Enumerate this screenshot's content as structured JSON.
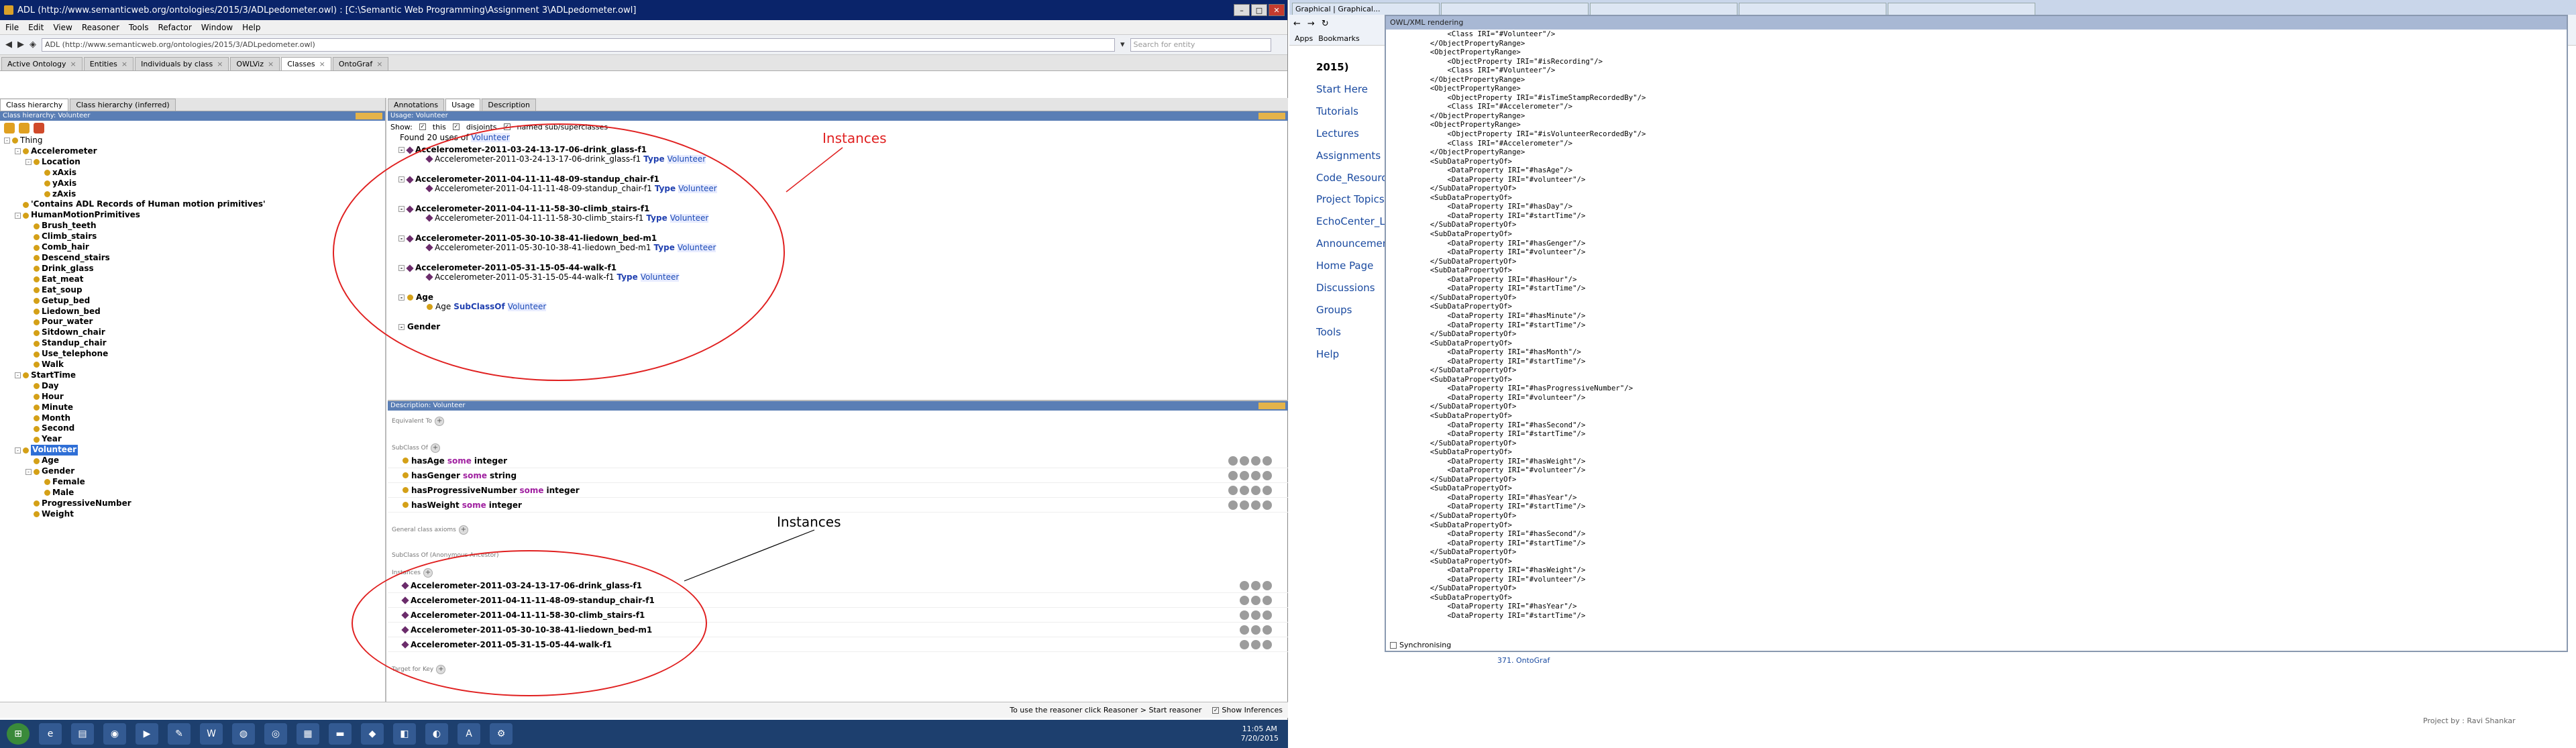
{
  "protege": {
    "title": "ADL (http://www.semanticweb.org/ontologies/2015/3/ADLpedometer.owl) : [C:\\Semantic Web Programming\\Assignment 3\\ADLpedometer.owl]",
    "menu": [
      "File",
      "Edit",
      "View",
      "Reasoner",
      "Tools",
      "Refactor",
      "Window",
      "Help"
    ],
    "iri": "ADL (http://www.semanticweb.org/ontologies/2015/3/ADLpedometer.owl)",
    "search_placeholder": "Search for entity",
    "tabs": [
      "Active Ontology",
      "Entities",
      "Individuals by class",
      "OWLViz",
      "Classes",
      "OntoGraf"
    ],
    "left_tabs": [
      "Class hierarchy",
      "Class hierarchy (inferred)"
    ],
    "left_header": "Class hierarchy: Volunteer",
    "tree": [
      {
        "label": "Thing",
        "depth": 0,
        "bold": false,
        "toggle": "-"
      },
      {
        "label": "Accelerometer",
        "depth": 1,
        "bold": true,
        "toggle": "-"
      },
      {
        "label": "Location",
        "depth": 2,
        "bold": true,
        "toggle": "-"
      },
      {
        "label": "xAxis",
        "depth": 3,
        "bold": true,
        "toggle": ""
      },
      {
        "label": "yAxis",
        "depth": 3,
        "bold": true,
        "toggle": ""
      },
      {
        "label": "zAxis",
        "depth": 3,
        "bold": true,
        "toggle": ""
      },
      {
        "label": "'Contains ADL Records of Human motion primitives'",
        "depth": 1,
        "bold": true,
        "toggle": ""
      },
      {
        "label": "HumanMotionPrimitives",
        "depth": 1,
        "bold": true,
        "toggle": "-"
      },
      {
        "label": "Brush_teeth",
        "depth": 2,
        "bold": true,
        "toggle": ""
      },
      {
        "label": "Climb_stairs",
        "depth": 2,
        "bold": true,
        "toggle": ""
      },
      {
        "label": "Comb_hair",
        "depth": 2,
        "bold": true,
        "toggle": ""
      },
      {
        "label": "Descend_stairs",
        "depth": 2,
        "bold": true,
        "toggle": ""
      },
      {
        "label": "Drink_glass",
        "depth": 2,
        "bold": true,
        "toggle": ""
      },
      {
        "label": "Eat_meat",
        "depth": 2,
        "bold": true,
        "toggle": ""
      },
      {
        "label": "Eat_soup",
        "depth": 2,
        "bold": true,
        "toggle": ""
      },
      {
        "label": "Getup_bed",
        "depth": 2,
        "bold": true,
        "toggle": ""
      },
      {
        "label": "Liedown_bed",
        "depth": 2,
        "bold": true,
        "toggle": ""
      },
      {
        "label": "Pour_water",
        "depth": 2,
        "bold": true,
        "toggle": ""
      },
      {
        "label": "Sitdown_chair",
        "depth": 2,
        "bold": true,
        "toggle": ""
      },
      {
        "label": "Standup_chair",
        "depth": 2,
        "bold": true,
        "toggle": ""
      },
      {
        "label": "Use_telephone",
        "depth": 2,
        "bold": true,
        "toggle": ""
      },
      {
        "label": "Walk",
        "depth": 2,
        "bold": true,
        "toggle": ""
      },
      {
        "label": "StartTime",
        "depth": 1,
        "bold": true,
        "toggle": "-"
      },
      {
        "label": "Day",
        "depth": 2,
        "bold": true,
        "toggle": ""
      },
      {
        "label": "Hour",
        "depth": 2,
        "bold": true,
        "toggle": ""
      },
      {
        "label": "Minute",
        "depth": 2,
        "bold": true,
        "toggle": ""
      },
      {
        "label": "Month",
        "depth": 2,
        "bold": true,
        "toggle": ""
      },
      {
        "label": "Second",
        "depth": 2,
        "bold": true,
        "toggle": ""
      },
      {
        "label": "Year",
        "depth": 2,
        "bold": true,
        "toggle": ""
      },
      {
        "label": "Volunteer",
        "depth": 1,
        "bold": true,
        "toggle": "-",
        "selected": true
      },
      {
        "label": "Age",
        "depth": 2,
        "bold": true,
        "toggle": ""
      },
      {
        "label": "Gender",
        "depth": 2,
        "bold": true,
        "toggle": "-"
      },
      {
        "label": "Female",
        "depth": 3,
        "bold": true,
        "toggle": ""
      },
      {
        "label": "Male",
        "depth": 3,
        "bold": true,
        "toggle": ""
      },
      {
        "label": "ProgressiveNumber",
        "depth": 2,
        "bold": true,
        "toggle": ""
      },
      {
        "label": "Weight",
        "depth": 2,
        "bold": true,
        "toggle": ""
      }
    ],
    "right_tabs": [
      "Annotations",
      "Usage",
      "Description"
    ],
    "usage_header": "Usage: Volunteer",
    "usage_opts": {
      "show": "Show:",
      "this": "this",
      "disjoints": "disjoints",
      "named": "named sub/superclasses"
    },
    "found": {
      "prefix": "Found 20 uses of",
      "cls": "Volunteer"
    },
    "usage_groups": [
      {
        "head": "Accelerometer-2011-03-24-13-17-06-drink_glass-f1",
        "child": "Accelerometer-2011-03-24-13-17-06-drink_glass-f1",
        "kw": "Type",
        "target": "Volunteer"
      },
      {
        "head": "Accelerometer-2011-04-11-11-48-09-standup_chair-f1",
        "child": "Accelerometer-2011-04-11-11-48-09-standup_chair-f1",
        "kw": "Type",
        "target": "Volunteer"
      },
      {
        "head": "Accelerometer-2011-04-11-11-58-30-climb_stairs-f1",
        "child": "Accelerometer-2011-04-11-11-58-30-climb_stairs-f1",
        "kw": "Type",
        "target": "Volunteer"
      },
      {
        "head": "Accelerometer-2011-05-30-10-38-41-liedown_bed-m1",
        "child": "Accelerometer-2011-05-30-10-38-41-liedown_bed-m1",
        "kw": "Type",
        "target": "Volunteer"
      },
      {
        "head": "Accelerometer-2011-05-31-15-05-44-walk-f1",
        "child": "Accelerometer-2011-05-31-15-05-44-walk-f1",
        "kw": "Type",
        "target": "Volunteer"
      },
      {
        "head": "Age",
        "child": "Age",
        "kw": "SubClassOf",
        "target": "Volunteer"
      }
    ],
    "usage_tail": "Gender",
    "desc_header": "Description: Volunteer",
    "sections": {
      "equiv": "Equivalent To",
      "sub": "SubClass Of",
      "gca": "General class axioms",
      "subanon": "SubClass Of (Anonymous Ancestor)",
      "inst": "Instances",
      "target": "Target for Key"
    },
    "subclass_rows": [
      {
        "prop": "hasAge",
        "kw": "some",
        "type": "integer"
      },
      {
        "prop": "hasGenger",
        "kw": "some",
        "type": "string"
      },
      {
        "prop": "hasProgressiveNumber",
        "kw": "some",
        "type": "integer"
      },
      {
        "prop": "hasWeight",
        "kw": "some",
        "type": "integer"
      }
    ],
    "instances": [
      "Accelerometer-2011-03-24-13-17-06-drink_glass-f1",
      "Accelerometer-2011-04-11-11-48-09-standup_chair-f1",
      "Accelerometer-2011-04-11-11-58-30-climb_stairs-f1",
      "Accelerometer-2011-05-30-10-38-41-liedown_bed-m1",
      "Accelerometer-2011-05-31-15-05-44-walk-f1"
    ],
    "annot_top": "Instances",
    "annot_bottom": "Instances",
    "status": {
      "reasoner": "To use the reasoner click Reasoner > Start reasoner",
      "infer": "Show Inferences"
    }
  },
  "taskbar": {
    "time": "11:05 AM",
    "date": "7/20/2015"
  },
  "browser": {
    "tabs": [
      "Graphical | Graphical...",
      "",
      "",
      "",
      ""
    ],
    "bookmarks": [
      "Apps",
      "Bookmarks"
    ],
    "sidebar": [
      "2015)",
      "Start Here",
      "Tutorials",
      "Lectures",
      "Assignments",
      "Code_Resourc",
      "Project Topics",
      "EchoCenter_Le",
      "Announcement",
      "Home Page",
      "Discussions",
      "Groups",
      "Tools",
      "Help"
    ],
    "footer": "Project by : Ravi Shankar",
    "below": "371. OntoGraf"
  },
  "owl": {
    "title": "OWL/XML rendering",
    "sync": "Synchronising",
    "lines": [
      "        <Class IRI=\"#Volunteer\"/>",
      "    </ObjectPropertyRange>",
      "    <ObjectPropertyRange>",
      "        <ObjectProperty IRI=\"#isRecording\"/>",
      "        <Class IRI=\"#Volunteer\"/>",
      "    </ObjectPropertyRange>",
      "    <ObjectPropertyRange>",
      "        <ObjectProperty IRI=\"#isTimeStampRecordedBy\"/>",
      "        <Class IRI=\"#Accelerometer\"/>",
      "    </ObjectPropertyRange>",
      "    <ObjectPropertyRange>",
      "        <ObjectProperty IRI=\"#isVolunteerRecordedBy\"/>",
      "        <Class IRI=\"#Accelerometer\"/>",
      "    </ObjectPropertyRange>",
      "    <SubDataPropertyOf>",
      "        <DataProperty IRI=\"#hasAge\"/>",
      "        <DataProperty IRI=\"#volunteer\"/>",
      "    </SubDataPropertyOf>",
      "    <SubDataPropertyOf>",
      "        <DataProperty IRI=\"#hasDay\"/>",
      "        <DataProperty IRI=\"#startTime\"/>",
      "    </SubDataPropertyOf>",
      "    <SubDataPropertyOf>",
      "        <DataProperty IRI=\"#hasGenger\"/>",
      "        <DataProperty IRI=\"#volunteer\"/>",
      "    </SubDataPropertyOf>",
      "    <SubDataPropertyOf>",
      "        <DataProperty IRI=\"#hasHour\"/>",
      "        <DataProperty IRI=\"#startTime\"/>",
      "    </SubDataPropertyOf>",
      "    <SubDataPropertyOf>",
      "        <DataProperty IRI=\"#hasMinute\"/>",
      "        <DataProperty IRI=\"#startTime\"/>",
      "    </SubDataPropertyOf>",
      "    <SubDataPropertyOf>",
      "        <DataProperty IRI=\"#hasMonth\"/>",
      "        <DataProperty IRI=\"#startTime\"/>",
      "    </SubDataPropertyOf>",
      "    <SubDataPropertyOf>",
      "        <DataProperty IRI=\"#hasProgressiveNumber\"/>",
      "        <DataProperty IRI=\"#volunteer\"/>",
      "    </SubDataPropertyOf>",
      "    <SubDataPropertyOf>",
      "        <DataProperty IRI=\"#hasSecond\"/>",
      "        <DataProperty IRI=\"#startTime\"/>",
      "    </SubDataPropertyOf>",
      "    <SubDataPropertyOf>",
      "        <DataProperty IRI=\"#hasWeight\"/>",
      "        <DataProperty IRI=\"#volunteer\"/>",
      "    </SubDataPropertyOf>",
      "    <SubDataPropertyOf>",
      "        <DataProperty IRI=\"#hasYear\"/>",
      "        <DataProperty IRI=\"#startTime\"/>",
      "    </SubDataPropertyOf>",
      "    <SubDataPropertyOf>",
      "        <DataProperty IRI=\"#hasSecond\"/>",
      "        <DataProperty IRI=\"#startTime\"/>",
      "    </SubDataPropertyOf>",
      "    <SubDataPropertyOf>",
      "        <DataProperty IRI=\"#hasWeight\"/>",
      "        <DataProperty IRI=\"#volunteer\"/>",
      "    </SubDataPropertyOf>",
      "    <SubDataPropertyOf>",
      "        <DataProperty IRI=\"#hasYear\"/>",
      "        <DataProperty IRI=\"#startTime\"/>"
    ]
  },
  "colors": {
    "annotation": "#e02020",
    "selection": "#2f6fd6",
    "titlebar": "#0a246a"
  }
}
